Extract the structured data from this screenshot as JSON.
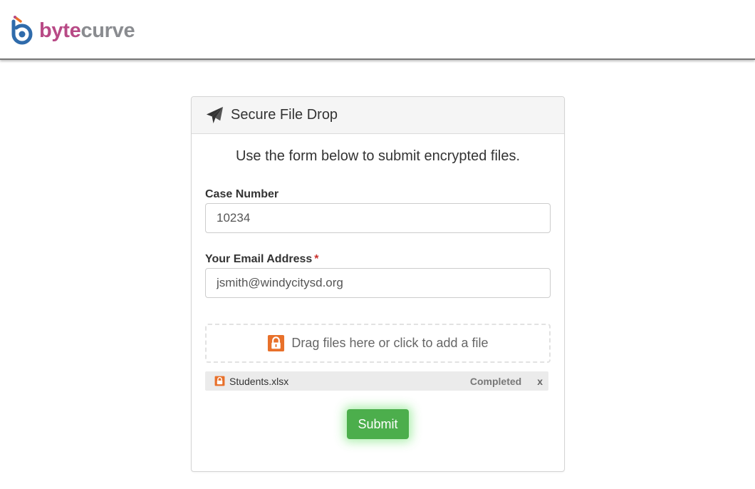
{
  "header": {
    "logo_text_part1": "byte",
    "logo_text_part2": "curve",
    "logo_icon": "bytecurve-logo-icon",
    "brand_colors": {
      "pink": "#b84a86",
      "gray": "#8a8c90",
      "blue": "#2f6bab"
    }
  },
  "panel": {
    "title": "Secure File Drop",
    "title_icon": "paper-plane-icon",
    "intro": "Use the form below to submit encrypted files."
  },
  "form": {
    "case_number": {
      "label": "Case Number",
      "value": "10234"
    },
    "email": {
      "label": "Your Email Address",
      "required_marker": "*",
      "value": "jsmith@windycitysd.org"
    },
    "dropzone": {
      "icon": "lock-icon",
      "text": "Drag files here or click to add a file"
    },
    "files": [
      {
        "name": "Students.xlsx",
        "status": "Completed",
        "remove_label": "x",
        "icon": "lock-icon"
      }
    ],
    "submit_label": "Submit"
  },
  "colors": {
    "accent_orange": "#e8702a",
    "submit_green": "#4cae4c",
    "required_red": "#c9302c"
  }
}
